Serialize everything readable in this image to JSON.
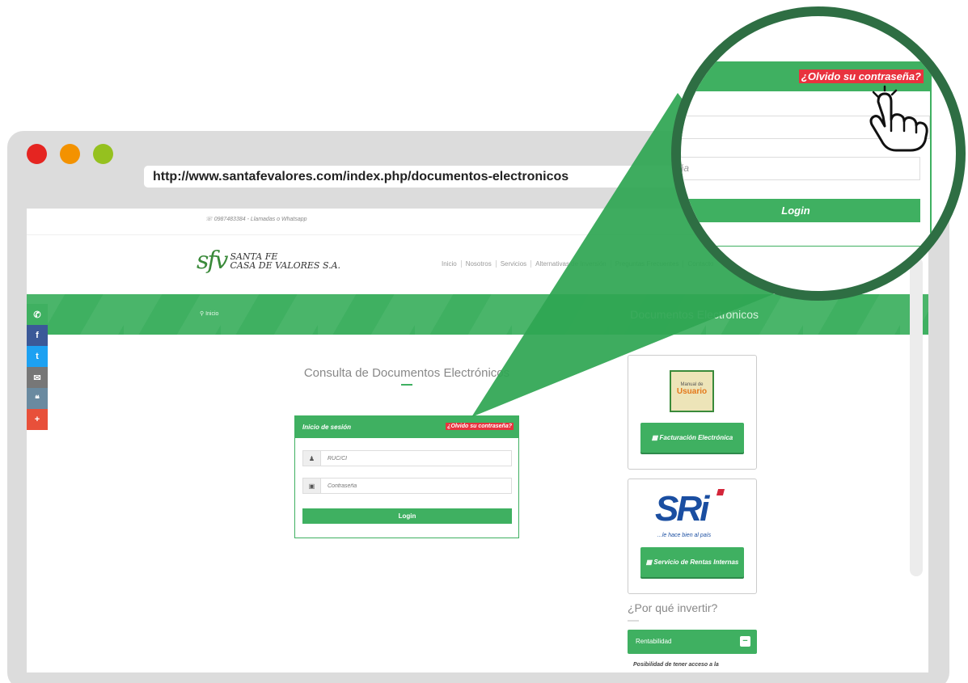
{
  "browser": {
    "url": "http://www.santafevalores.com/index.php/documentos-electronicos"
  },
  "site": {
    "topbar_phone": "0987483384 - Llamadas o Whatsapp",
    "logo_mark": "sfv",
    "logo_line1": "SANTA FE",
    "logo_line2": "CASA DE VALORES S.A.",
    "nav": [
      "Inicio",
      "Nosotros",
      "Servicios",
      "Alternativas de Inversión",
      "Preguntas Frecuentes",
      "Contacto"
    ],
    "breadcrumb": "Inicio",
    "page_title": "Documentos Electrónicos"
  },
  "social": [
    {
      "icon": "whatsapp-icon",
      "glyph": "✆",
      "color": "#3fb061"
    },
    {
      "icon": "facebook-icon",
      "glyph": "f",
      "color": "#3b5998"
    },
    {
      "icon": "twitter-icon",
      "glyph": "t",
      "color": "#1da1f2"
    },
    {
      "icon": "email-icon",
      "glyph": "✉",
      "color": "#777777"
    },
    {
      "icon": "chat-icon",
      "glyph": "❝",
      "color": "#6a8aa0"
    },
    {
      "icon": "plus-icon",
      "glyph": "+",
      "color": "#e8503a"
    }
  ],
  "main": {
    "consulta_title": "Consulta de Documentos Electrónicos"
  },
  "login": {
    "title": "Inicio de sesión",
    "forgot": "¿Olvido su contraseña?",
    "user_placeholder": "RUC/CI",
    "password_placeholder": "Contraseña",
    "login_button": "Login"
  },
  "sidebar": {
    "manual_line1": "Manual de",
    "manual_line2": "Usuario",
    "facturacion_button": "Facturación Electrónica",
    "sri_logo": "SRi",
    "sri_tagline": "...le hace bien al país",
    "sri_button": "Servicio de Rentas Internas",
    "invertir_title": "¿Por qué invertir?",
    "rentabilidad_label": "Rentabilidad",
    "rentabilidad_text": "Posibilidad de tener acceso a la"
  },
  "magnifier": {
    "forgot": "¿Olvido su contraseña?",
    "password_partial": "eña",
    "login_button": "Login"
  },
  "colors": {
    "brand_green": "#3fb061",
    "dark_green": "#2e6e43",
    "forgot_red": "#e8323e",
    "sri_blue": "#1a4ea1"
  }
}
